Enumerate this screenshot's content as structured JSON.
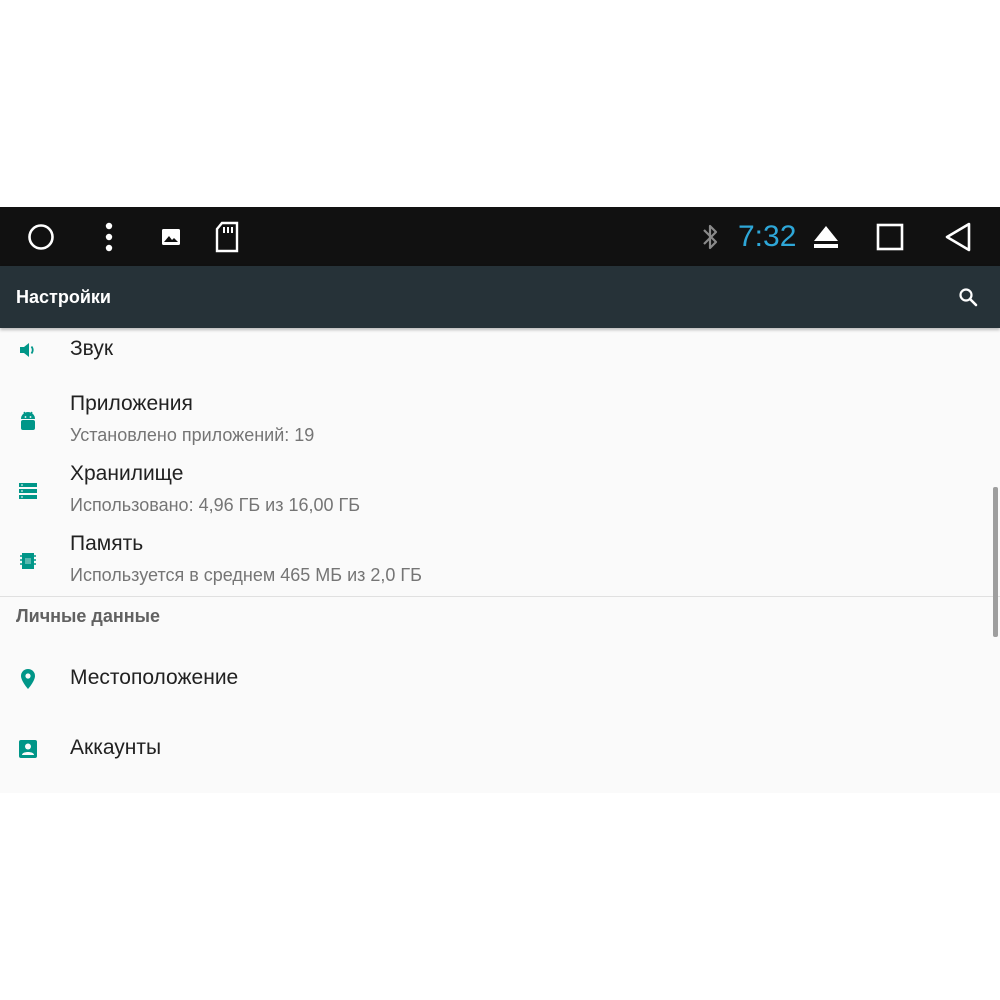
{
  "status_bar": {
    "time": "7:32",
    "icons": [
      "home-circle-icon",
      "menu-dots-icon",
      "image-icon",
      "sd-card-icon",
      "bluetooth-icon",
      "eject-icon",
      "recents-icon",
      "back-icon"
    ]
  },
  "toolbar": {
    "title": "Настройки",
    "search_icon": "search-icon"
  },
  "settings": {
    "sound": {
      "label": "Звук",
      "icon": "volume-icon"
    },
    "apps": {
      "label": "Приложения",
      "summary": "Установлено приложений: 19",
      "icon": "android-icon"
    },
    "storage": {
      "label": "Хранилище",
      "summary": "Использовано: 4,96 ГБ из 16,00 ГБ",
      "icon": "storage-icon"
    },
    "memory": {
      "label": "Память",
      "summary": "Используется в среднем 465 МБ из 2,0 ГБ",
      "icon": "memory-chip-icon"
    },
    "personal_header": "Личные данные",
    "location": {
      "label": "Местоположение",
      "icon": "location-pin-icon"
    },
    "accounts": {
      "label": "Аккаунты",
      "icon": "account-icon"
    }
  },
  "colors": {
    "accent": "#009688",
    "toolbar": "#263238",
    "status_bar": "#111111",
    "clock": "#2ea7d8"
  }
}
